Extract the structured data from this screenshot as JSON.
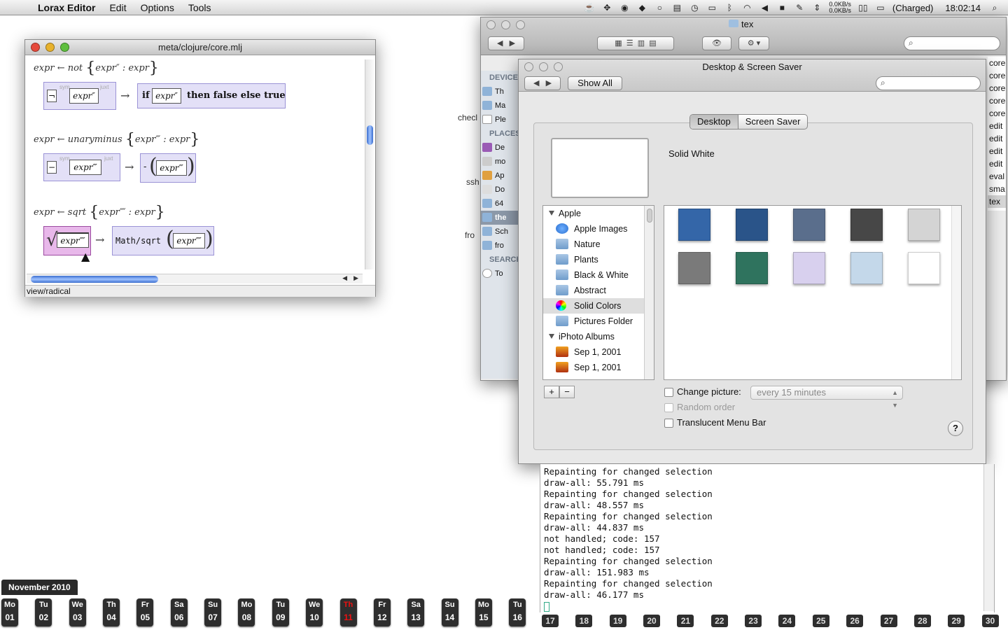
{
  "menubar": {
    "app_name": "Lorax Editor",
    "items": [
      "Edit",
      "Options",
      "Tools"
    ],
    "net_up": "0.0KB/s",
    "net_down": "0.0KB/s",
    "battery": "(Charged)",
    "clock": "18:02:14"
  },
  "lorax": {
    "title": "meta/clojure/core.mlj",
    "status": "view/radical",
    "rules": [
      {
        "head": "expr ← not",
        "pattern": "expr″ : expr",
        "lhs_op": "¬",
        "lhs_sym": "sym",
        "lhs_juxt": "juxt",
        "lhs_var": "expr″",
        "rhs_if": "if",
        "rhs_var": "expr″",
        "rhs_then": "then false else true"
      },
      {
        "head": "expr ← unaryminus",
        "pattern": "expr‴ : expr",
        "lhs_op": "−",
        "lhs_sym": "sym",
        "lhs_juxt": "juxt",
        "lhs_var": "expr‴",
        "rhs_minus": "-",
        "rhs_var": "expr‴"
      },
      {
        "head": "expr ← sqrt",
        "pattern": "expr⁗ : expr",
        "lhs_var": "expr⁗",
        "rhs_fn": "Math/sqrt",
        "rhs_var": "expr⁗"
      }
    ],
    "arrow": "→"
  },
  "finder": {
    "title": "tex",
    "sidebar_heads": [
      "DEVICES",
      "PLACES",
      "SEARCH FOR"
    ],
    "devices": [
      "Th",
      "Ma",
      "Ple"
    ],
    "places": [
      "De",
      "mo",
      "Ap",
      "Do",
      "64",
      "the",
      "Sch",
      "fro"
    ],
    "search": [
      "To"
    ],
    "right_column": [
      "core",
      "core",
      "core",
      "core",
      "core",
      "edit",
      "edit",
      "edit",
      "edit",
      "eval",
      "sma",
      "tex"
    ]
  },
  "dss": {
    "title": "Desktop & Screen Saver",
    "show_all": "Show All",
    "tabs": [
      "Desktop",
      "Screen Saver"
    ],
    "preview_label": "Solid White",
    "groups": [
      {
        "name": "Apple",
        "items": [
          "Apple Images",
          "Nature",
          "Plants",
          "Black & White",
          "Abstract",
          "Solid Colors",
          "Pictures Folder"
        ]
      },
      {
        "name": "iPhoto Albums",
        "items": [
          "Sep 1, 2001",
          "Sep 1, 2001"
        ]
      }
    ],
    "selected_item": "Solid Colors",
    "swatches": [
      "#3466a8",
      "#2a5489",
      "#5a6e8c",
      "#474747",
      "#d4d4d4",
      "#7a7a7a",
      "#2f735e",
      "#d8d0ee",
      "#c4d8ea",
      "#ffffff"
    ],
    "add_label": "+",
    "remove_label": "−",
    "change_picture_label": "Change picture:",
    "change_picture_value": "every 15 minutes",
    "random_order_label": "Random order",
    "translucent_label": "Translucent Menu Bar",
    "help_label": "?"
  },
  "console": {
    "lines": [
      "Repainting for changed selection",
      "draw-all: 55.791 ms",
      "Repainting for changed selection",
      "draw-all: 48.557 ms",
      "Repainting for changed selection",
      "draw-all: 44.837 ms",
      "not handled; code:  157",
      "not handled; code:  157",
      "Repainting for changed selection",
      "draw-all: 151.983 ms",
      "Repainting for changed selection",
      "draw-all: 46.177 ms"
    ]
  },
  "side_labels": [
    "checl",
    "ssh",
    "fro"
  ],
  "calendar": {
    "month": "November 2010",
    "days": [
      {
        "n": "Mo",
        "d": "01"
      },
      {
        "n": "Tu",
        "d": "02"
      },
      {
        "n": "We",
        "d": "03"
      },
      {
        "n": "Th",
        "d": "04"
      },
      {
        "n": "Fr",
        "d": "05"
      },
      {
        "n": "Sa",
        "d": "06"
      },
      {
        "n": "Su",
        "d": "07"
      },
      {
        "n": "Mo",
        "d": "08"
      },
      {
        "n": "Tu",
        "d": "09"
      },
      {
        "n": "We",
        "d": "10"
      },
      {
        "n": "Th",
        "d": "11"
      },
      {
        "n": "Fr",
        "d": "12"
      },
      {
        "n": "Sa",
        "d": "13"
      },
      {
        "n": "Su",
        "d": "14"
      },
      {
        "n": "Mo",
        "d": "15"
      },
      {
        "n": "Tu",
        "d": "16"
      }
    ],
    "today": "11",
    "later_days": [
      "17",
      "18",
      "19",
      "20",
      "21",
      "22",
      "23",
      "24",
      "25",
      "26",
      "27",
      "28",
      "29",
      "30"
    ]
  }
}
